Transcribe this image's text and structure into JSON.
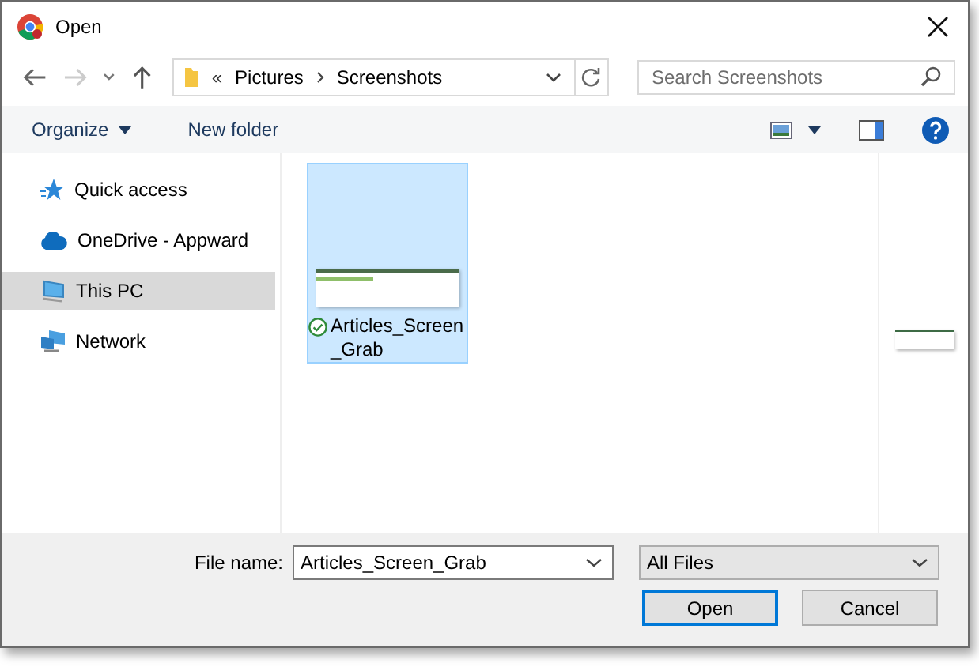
{
  "window": {
    "title": "Open"
  },
  "navigation": {
    "back_enabled": true,
    "forward_enabled": false,
    "overflow_marker": "«",
    "path": [
      "Pictures",
      "Screenshots"
    ]
  },
  "search": {
    "placeholder": "Search Screenshots"
  },
  "toolbar": {
    "organize": "Organize",
    "new_folder": "New folder"
  },
  "sidebar": {
    "items": [
      {
        "kind": "star",
        "label": "Quick access",
        "selected": false
      },
      {
        "kind": "cloud",
        "label": "OneDrive - Appward",
        "selected": false
      },
      {
        "kind": "computer",
        "label": "This PC",
        "selected": true
      },
      {
        "kind": "network",
        "label": "Network",
        "selected": false
      }
    ]
  },
  "files": [
    {
      "name": "Articles_Screen_Grab",
      "selected": true,
      "synced": true
    }
  ],
  "footer": {
    "file_name_label": "File name:",
    "file_name": "Articles_Screen_Grab",
    "file_type": "All Files",
    "buttons": [
      {
        "label": "Open",
        "default": true
      },
      {
        "label": "Cancel",
        "default": false
      }
    ]
  }
}
